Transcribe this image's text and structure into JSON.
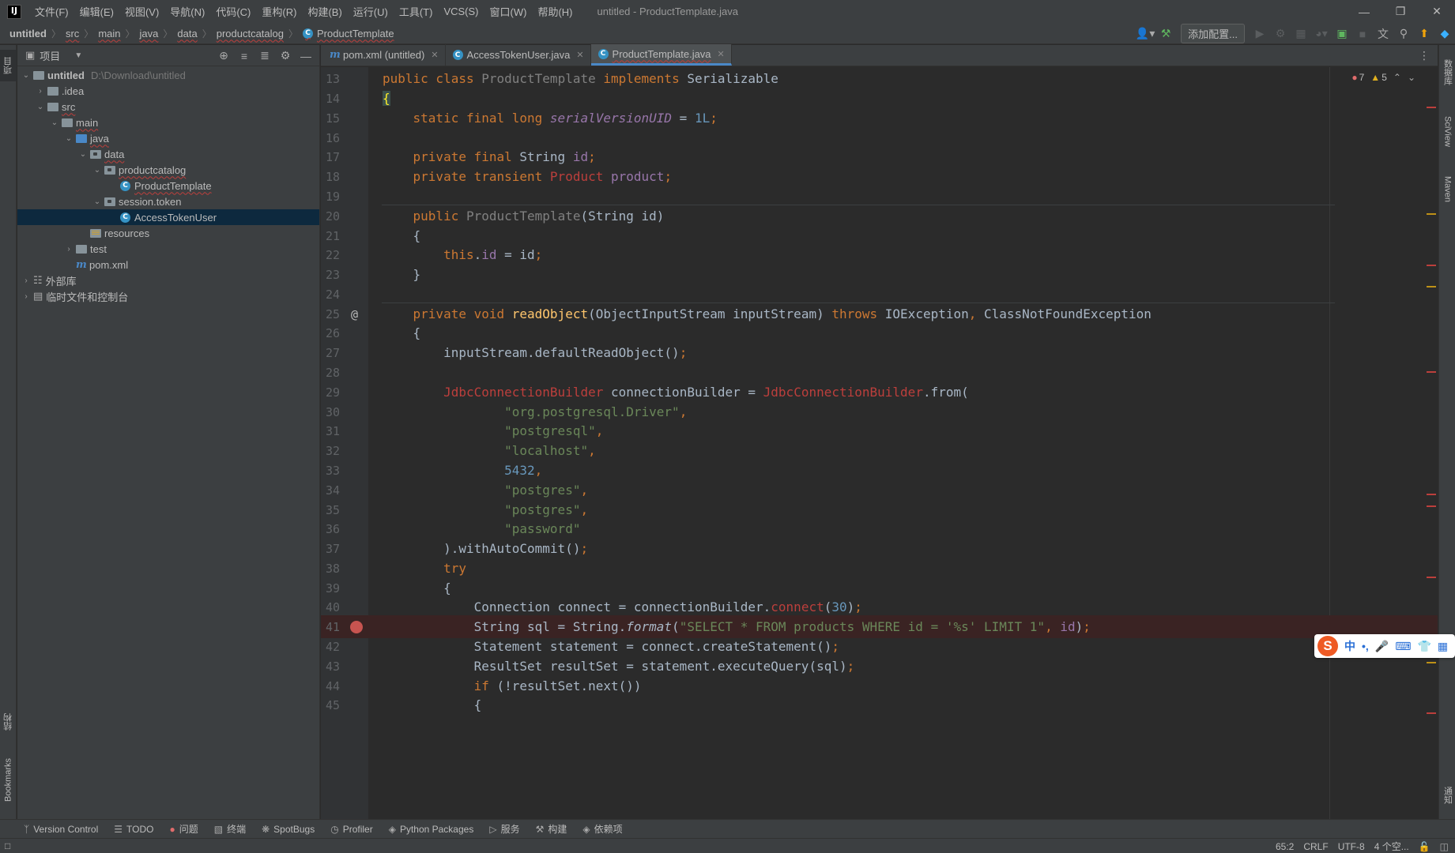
{
  "app": {
    "logo_text": "IJ",
    "window_title": "untitled - ProductTemplate.java"
  },
  "menu": [
    "文件(F)",
    "编辑(E)",
    "视图(V)",
    "导航(N)",
    "代码(C)",
    "重构(R)",
    "构建(B)",
    "运行(U)",
    "工具(T)",
    "VCS(S)",
    "窗口(W)",
    "帮助(H)"
  ],
  "breadcrumb": [
    "untitled",
    "src",
    "main",
    "java",
    "data",
    "productcatalog",
    "ProductTemplate"
  ],
  "navbar": {
    "add_config_label": "添加配置..."
  },
  "left_stripe": {
    "project_tab": "项目",
    "structure_tab": "结构",
    "bookmarks_tab": "Bookmarks"
  },
  "right_stripe": {
    "database_tab": "数据库",
    "sciview_tab": "SciView",
    "maven_tab": "Maven",
    "notifications_tab": "通知"
  },
  "project_panel": {
    "title": "项目",
    "tree": {
      "root_name": "untitled",
      "root_path": "D:\\Download\\untitled",
      "idea": ".idea",
      "src": "src",
      "main": "main",
      "java": "java",
      "data": "data",
      "productcatalog": "productcatalog",
      "product_template": "ProductTemplate",
      "session_token": "session.token",
      "access_token_user": "AccessTokenUser",
      "resources": "resources",
      "test": "test",
      "pom": "pom.xml",
      "external_libs": "外部库",
      "scratches": "临时文件和控制台"
    }
  },
  "tabs": [
    {
      "label": "pom.xml (untitled)",
      "icon": "maven-icon",
      "active": false
    },
    {
      "label": "AccessTokenUser.java",
      "icon": "class-icon",
      "active": false
    },
    {
      "label": "ProductTemplate.java",
      "icon": "class-icon",
      "active": true
    }
  ],
  "editor": {
    "inspections": {
      "errors": "7",
      "warnings": "5"
    },
    "line_numbers": [
      "13",
      "14",
      "15",
      "16",
      "17",
      "18",
      "19",
      "20",
      "21",
      "22",
      "23",
      "24",
      "25",
      "26",
      "27",
      "28",
      "29",
      "30",
      "31",
      "32",
      "33",
      "34",
      "35",
      "36",
      "37",
      "38",
      "39",
      "40",
      "41",
      "42",
      "43",
      "44",
      "45"
    ],
    "breakpoint_line": "41"
  },
  "ime": {
    "logo": "S",
    "items": [
      "中",
      "•,",
      "🎤",
      "⌨",
      "👕",
      "▦"
    ]
  },
  "bottom_tools": [
    {
      "label": "Version Control",
      "icon": "branch-icon"
    },
    {
      "label": "TODO",
      "icon": "list-icon"
    },
    {
      "label": "问题",
      "icon": "error-icon"
    },
    {
      "label": "终端",
      "icon": "terminal-icon"
    },
    {
      "label": "SpotBugs",
      "icon": "bug-icon"
    },
    {
      "label": "Profiler",
      "icon": "profiler-icon"
    },
    {
      "label": "Python Packages",
      "icon": "layers-icon"
    },
    {
      "label": "服务",
      "icon": "play-icon"
    },
    {
      "label": "构建",
      "icon": "hammer-icon"
    },
    {
      "label": "依赖项",
      "icon": "layers-icon"
    }
  ],
  "statusbar": {
    "position": "65:2",
    "line_sep": "CRLF",
    "encoding": "UTF-8",
    "indent": "4 个空..."
  }
}
